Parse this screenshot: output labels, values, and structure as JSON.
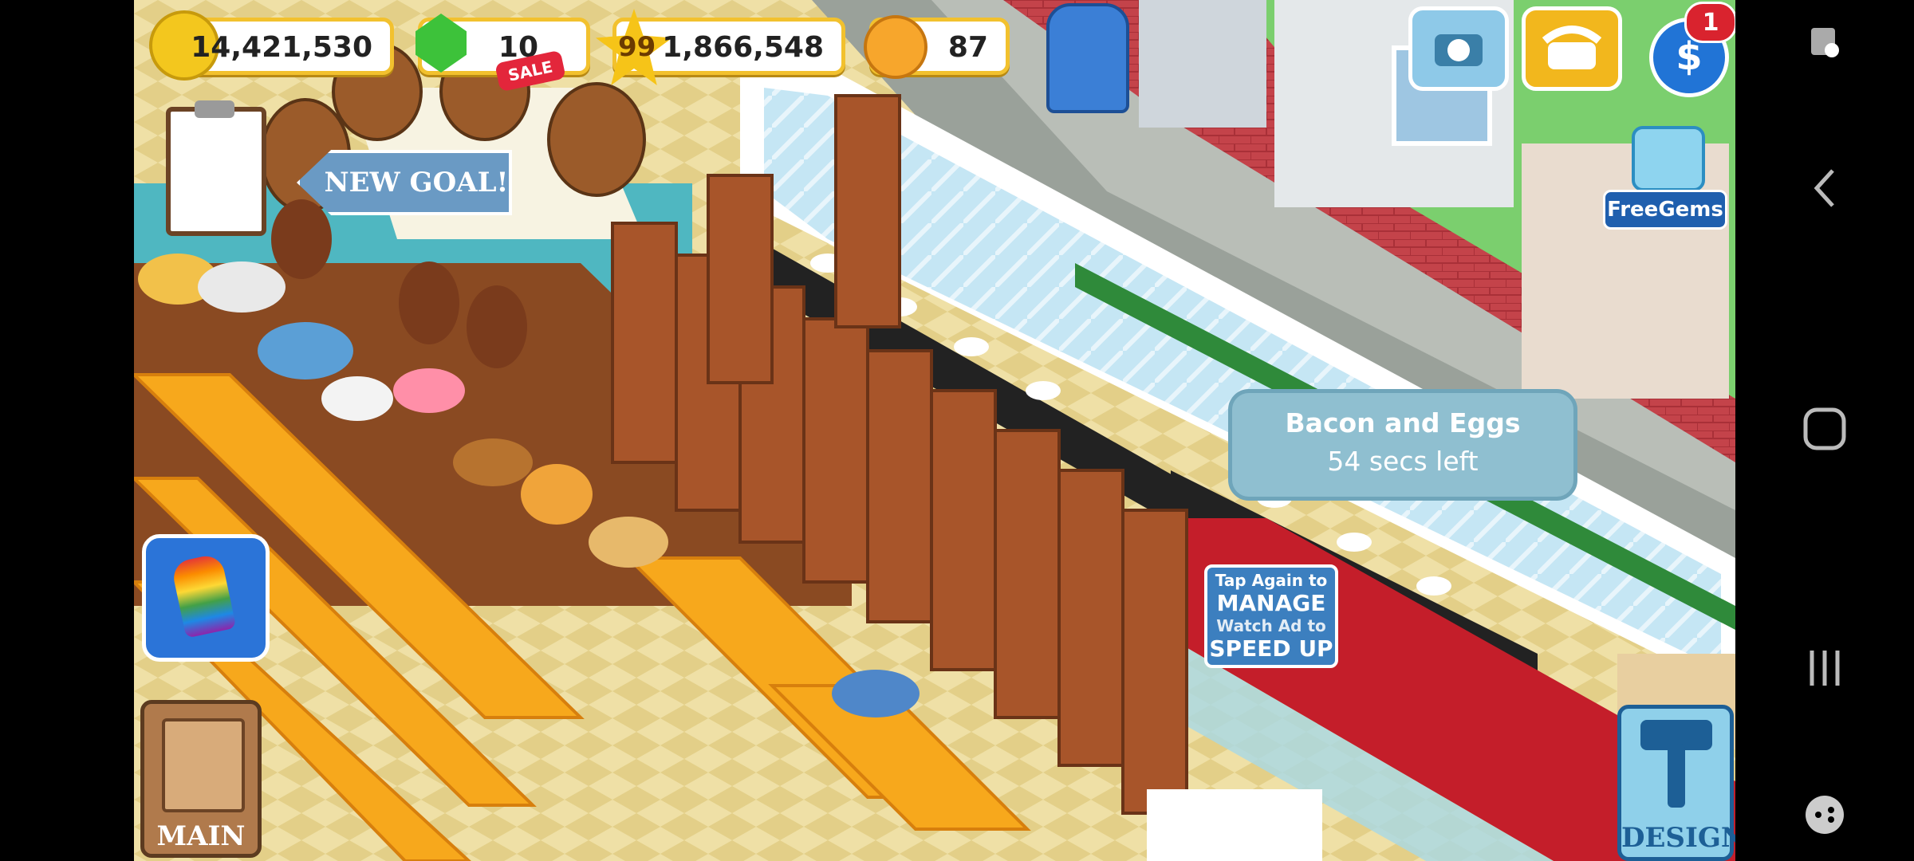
{
  "hud": {
    "coins": "14,421,530",
    "gems": "10",
    "sale_tag": "SALE",
    "level": "99",
    "xp": "1,866,548",
    "happiness": "87"
  },
  "top_buttons": {
    "notification_count": "1",
    "free_gems_label": "FreeGems"
  },
  "goal_banner": "NEW GOAL!",
  "tooltip": {
    "title": "Bacon and Eggs",
    "subtitle": "54 secs left"
  },
  "manage_prompt": {
    "line1": "Tap Again to",
    "line2": "MANAGE",
    "line3": "Watch Ad to",
    "line4": "SPEED UP"
  },
  "bottom_buttons": {
    "main_label": "MAIN",
    "design_label": "DESIGN"
  },
  "colors": {
    "hud_border": "#f2c12e",
    "tooltip_bg": "#8fbfd0",
    "floor_tile": "#e9d89a",
    "table_orange": "#f7a81c",
    "counter_red": "#c41e2a"
  },
  "nav_icons": [
    "screenshot-icon",
    "back-icon",
    "home-icon",
    "recent-apps-icon",
    "game-tools-icon"
  ]
}
